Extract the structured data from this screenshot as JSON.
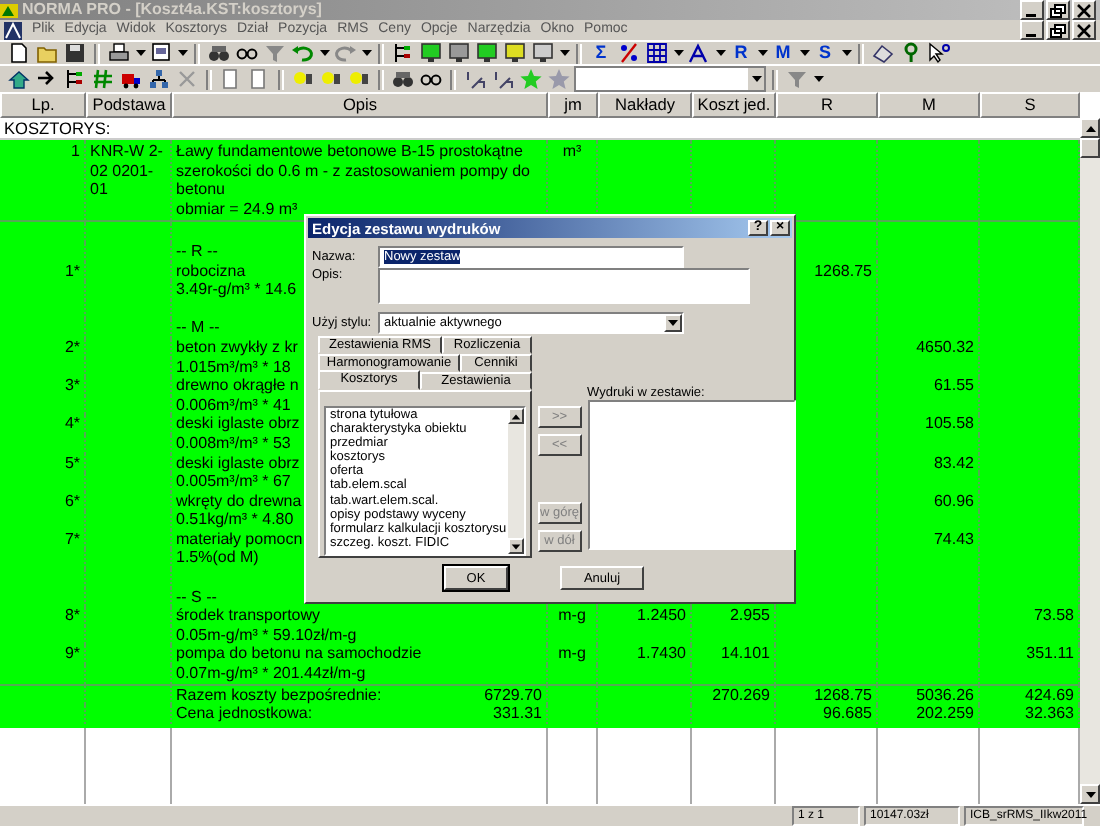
{
  "window": {
    "title": "NORMA PRO - [Koszt4a.KST:kosztorys]",
    "active": false
  },
  "menu": [
    "Plik",
    "Edycja",
    "Widok",
    "Kosztorys",
    "Dział",
    "Pozycja",
    "RMS",
    "Ceny",
    "Opcje",
    "Narzędzia",
    "Okno",
    "Pomoc"
  ],
  "toolbar_1": [
    "Σ",
    "R",
    "M",
    "S"
  ],
  "table": {
    "columns": [
      "Lp.",
      "Podstawa",
      "Opis",
      "jm",
      "Nakłady",
      "Koszt jed.",
      "R",
      "M",
      "S"
    ],
    "section": "KOSZTORYS:",
    "position": {
      "lp": "1",
      "podstawa": "KNR-W 2-02 0201-01",
      "opis": "Ławy fundamentowe betonowe B-15 prostokątne szerokości do 0.6 m - z zastosowaniem pompy do betonu",
      "obmiar": "obmiar  = 24.9 m³",
      "jm": "m³"
    },
    "lines": [
      {
        "kind": "blank"
      },
      {
        "kind": "text",
        "opis": "-- R --"
      },
      {
        "kind": "text",
        "lp": "1*",
        "opis": "robocizna",
        "r": "1268.75"
      },
      {
        "kind": "text",
        "opis": "3.49r-g/m³ * 14.6"
      },
      {
        "kind": "blank"
      },
      {
        "kind": "text",
        "opis": "-- M --"
      },
      {
        "kind": "text",
        "lp": "2*",
        "opis": "beton zwykły z kr",
        "m": "4650.32"
      },
      {
        "kind": "text",
        "opis": "1.015m³/m³ * 18"
      },
      {
        "kind": "text",
        "lp": "3*",
        "opis": "drewno okrągłe n",
        "m": "61.55"
      },
      {
        "kind": "text",
        "opis": "0.006m³/m³ * 41"
      },
      {
        "kind": "text",
        "lp": "4*",
        "opis": "deski iglaste obrz",
        "m": "105.58"
      },
      {
        "kind": "text",
        "opis": "0.008m³/m³ * 53"
      },
      {
        "kind": "text",
        "lp": "5*",
        "opis": "deski iglaste obrz",
        "m": "83.42"
      },
      {
        "kind": "text",
        "opis": "0.005m³/m³ * 67"
      },
      {
        "kind": "text",
        "lp": "6*",
        "opis": "wkręty do drewna",
        "m": "60.96"
      },
      {
        "kind": "text",
        "opis": "0.51kg/m³ * 4.80"
      },
      {
        "kind": "text",
        "lp": "7*",
        "opis": "materiały pomocn",
        "m": "74.43"
      },
      {
        "kind": "text",
        "opis": "1.5%(od M)"
      },
      {
        "kind": "blank"
      },
      {
        "kind": "text",
        "opis": "-- S --"
      },
      {
        "kind": "text",
        "lp": "8*",
        "opis": "środek transportowy",
        "jm": "m-g",
        "naklady": "1.2450",
        "koszt": "2.955",
        "s": "73.58"
      },
      {
        "kind": "text",
        "opis": "0.05m-g/m³ * 59.10zł/m-g"
      },
      {
        "kind": "text",
        "lp": "9*",
        "opis": "pompa do betonu na samochodzie",
        "jm": "m-g",
        "naklady": "1.7430",
        "koszt": "14.101",
        "s": "351.11"
      },
      {
        "kind": "text",
        "opis": "0.07m-g/m³ * 201.44zł/m-g"
      }
    ],
    "totals": [
      {
        "label": "Razem koszty bezpośrednie:",
        "value": "6729.70",
        "koszt": "270.269",
        "r": "1268.75",
        "m": "5036.26",
        "s": "424.69"
      },
      {
        "label": "Cena jednostkowa:",
        "value": "331.31",
        "r": "96.685",
        "m": "202.259",
        "s": "32.363"
      }
    ]
  },
  "dialog": {
    "title": "Edycja zestawu wydruków",
    "title_buttons": [
      "?",
      "×"
    ],
    "fields": [
      {
        "kind": "text",
        "label": "Nazwa:",
        "value": "Nowy zestaw",
        "highlighted": true
      },
      {
        "kind": "area",
        "label": "Opis:"
      },
      {
        "kind": "select",
        "label": "Użyj stylu:",
        "value": "aktualnie aktywnego"
      }
    ],
    "tab_rows": [
      [
        {
          "label": "Zestawienia RMS",
          "selected": false
        },
        {
          "label": "Rozliczenia",
          "selected": false
        }
      ],
      [
        {
          "label": "Harmonogramowanie",
          "selected": false
        },
        {
          "label": "Cenniki",
          "selected": false
        }
      ],
      [
        {
          "label": "Kosztorys",
          "selected": true
        },
        {
          "label": "Zestawienia",
          "selected": false
        }
      ]
    ],
    "available": [
      "strona tytułowa",
      "charakterystyka obiektu",
      "przedmiar",
      "kosztorys",
      "oferta",
      "tab.elem.scal",
      "tab.wart.elem.scal.",
      "opisy podstawy wyceny",
      "formularz kalkulacji kosztorysu",
      "szczeg. koszt. FIDIC"
    ],
    "move_buttons": [
      {
        "label": ">>",
        "disabled": true
      },
      {
        "label": "<<",
        "disabled": true
      },
      {
        "label": "w górę",
        "disabled": true
      },
      {
        "label": "w dół",
        "disabled": true
      }
    ],
    "chosen_label": "Wydruki w zestawie:",
    "buttons": [
      "OK",
      "Anuluj"
    ]
  },
  "status_bar": [
    "1 z 1",
    "10147.03zł",
    "ICB_srRMS_IIkw2011"
  ]
}
